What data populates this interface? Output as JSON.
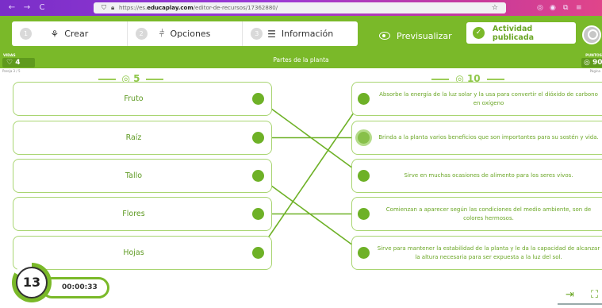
{
  "browser": {
    "url_prefix": "https://es.",
    "url_domain": "educaplay.com",
    "url_rest": "/editor-de-recursos/17362880/",
    "back_icon": "←",
    "forward_icon": "→",
    "reload_icon": "C"
  },
  "toolbar": {
    "tabs": [
      {
        "num": "1",
        "label": "Crear",
        "icon": "puzzle-icon"
      },
      {
        "num": "2",
        "label": "Opciones",
        "icon": "sliders-icon"
      },
      {
        "num": "3",
        "label": "Información",
        "icon": "list-icon"
      }
    ],
    "preview_label": "Previsualizar",
    "published_label": "Actividad publicada"
  },
  "game": {
    "vidas_label": "VIDAS",
    "vidas_value": "♡ 4",
    "title": "Partes de la planta",
    "puntos_label": "PUNTOS",
    "puntos_value": "◎ 90",
    "pareja": "Pareja 3 / 5",
    "pagina": "Página",
    "left_score": "◎ 5",
    "right_score": "◎ 10",
    "left_items": [
      "Fruto",
      "Raíz",
      "Tallo",
      "Flores",
      "Hojas"
    ],
    "right_items": [
      "Absorbe la energía de la luz solar y la usa para convertir el dióxido de carbono en oxígeno",
      "Brinda a la planta varios beneficios que son importantes para su sostén y vida.",
      "Sirve en muchas ocasiones de alimento para los seres vivos.",
      "Comienzan a aparecer según las condiciones del medio ambiente, son de colores hermosos.",
      "Sirve para mantener la estabilidad de la planta y le da la capacidad de alcanzar la altura necesaria para ser expuesta a la luz del sol."
    ],
    "connections": [
      [
        0,
        2
      ],
      [
        1,
        1
      ],
      [
        2,
        4
      ],
      [
        3,
        3
      ],
      [
        4,
        0
      ]
    ],
    "selected_right": 1
  },
  "timer": {
    "count": "13",
    "elapsed": "00:00:33"
  },
  "colors": {
    "brand_green": "#7ab929",
    "dot_green": "#6eb127"
  }
}
